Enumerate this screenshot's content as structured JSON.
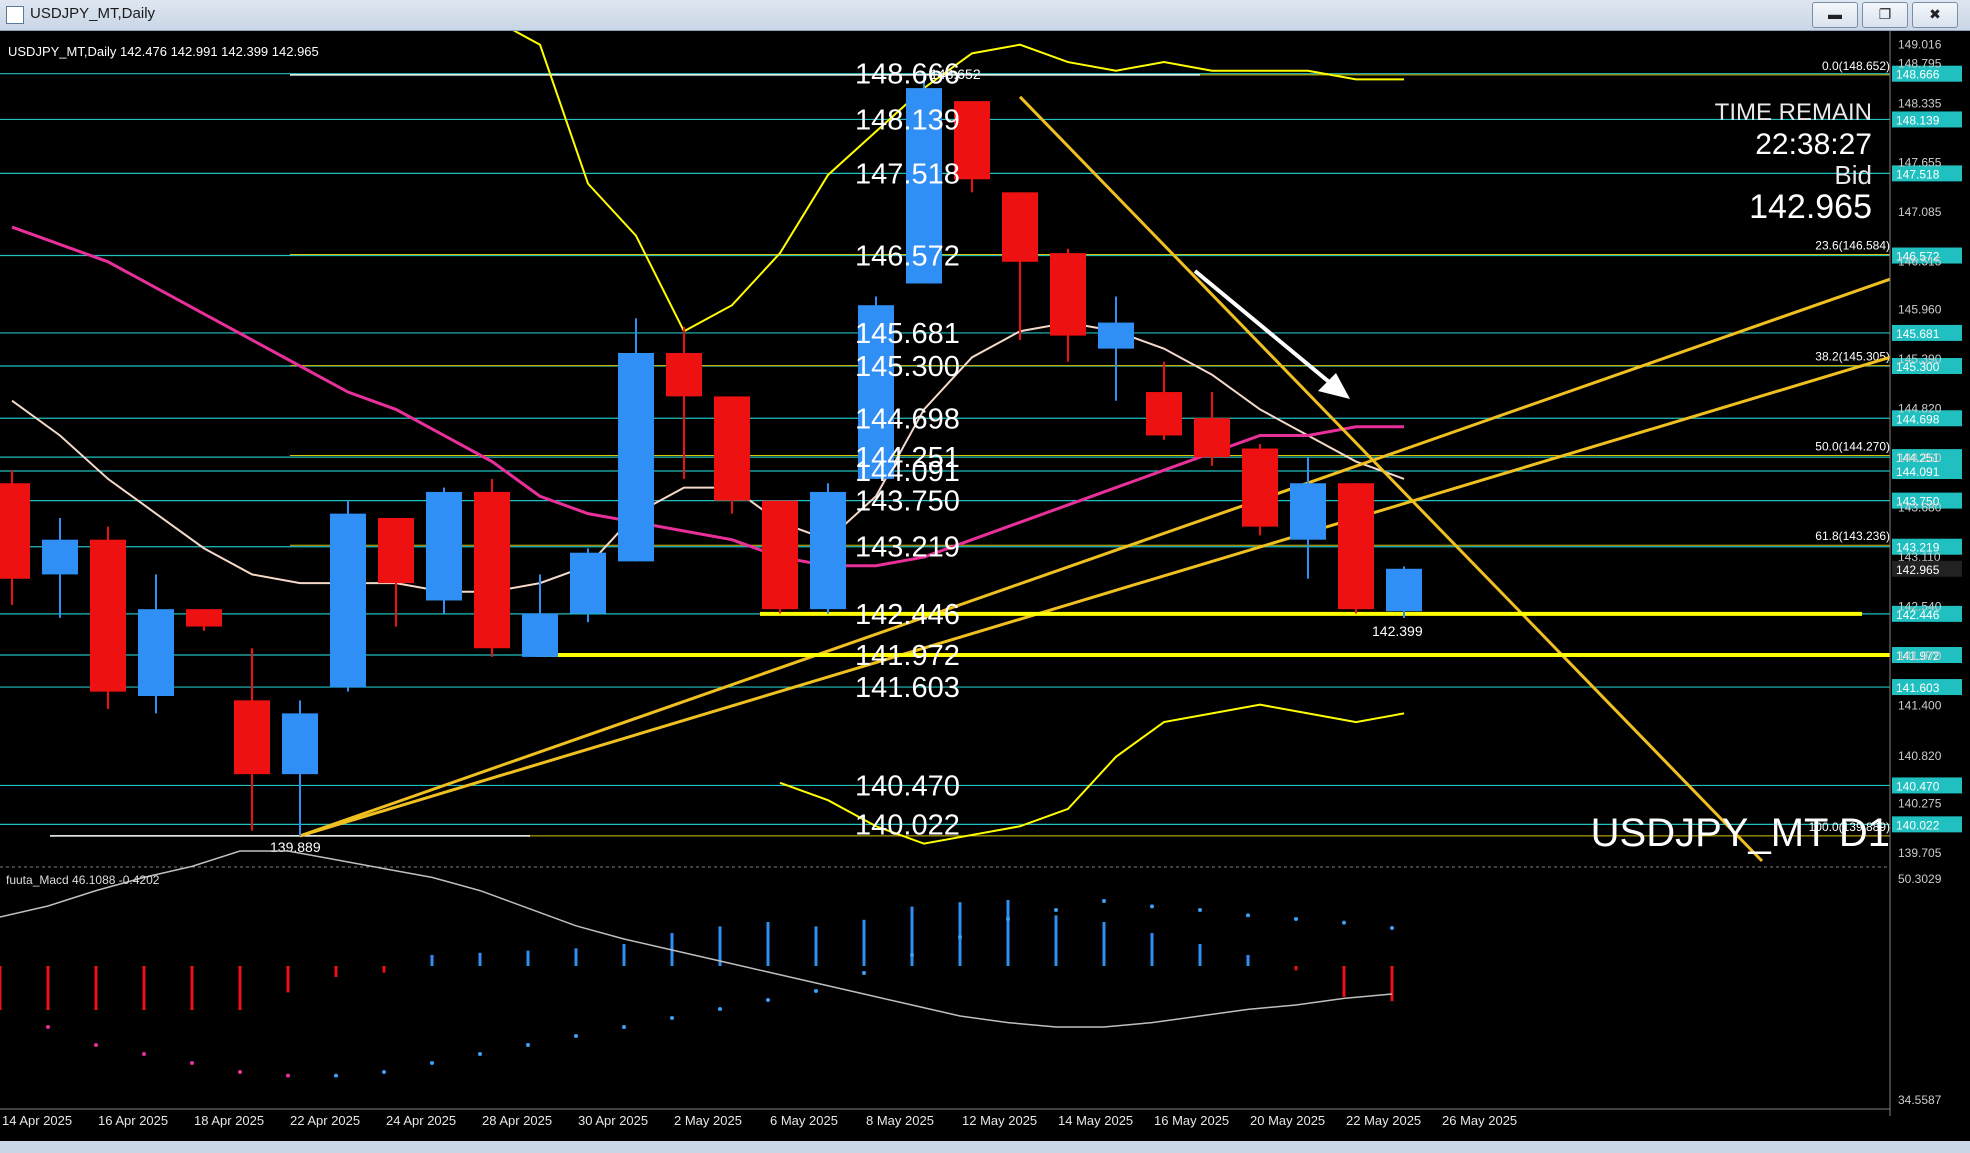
{
  "window": {
    "title": "USDJPY_MT,Daily",
    "buttons": [
      "minimize",
      "maximize",
      "close"
    ]
  },
  "header_info": "USDJPY_MT,Daily  142.476 142.991 142.399 142.965",
  "watermark": "USDJPY_MT D1",
  "time_remain": {
    "label": "TIME REMAIN",
    "value": "22:38:27",
    "bid_label": "Bid",
    "bid_value": "142.965"
  },
  "indicator_label": "fuuta_Macd 46.1088  -0.4202",
  "colors": {
    "bull": "#2f8ff5",
    "bear": "#ee1111",
    "background": "#000000",
    "hline": "#20c0c0",
    "fib": "#d8c000",
    "trend": "#f0c020",
    "bollinger": "#ffff00",
    "support": "#ffff00",
    "ma_pink": "#e8309a",
    "ma_white": "#f4d8c8"
  },
  "chart_data": {
    "type": "candlestick",
    "symbol": "USDJPY_MT",
    "timeframe": "Daily",
    "ohlc_current": {
      "open": 142.476,
      "high": 142.991,
      "low": 142.399,
      "close": 142.965
    },
    "candles": [
      {
        "o": 143.95,
        "h": 144.1,
        "l": 142.55,
        "c": 142.85
      },
      {
        "o": 142.9,
        "h": 143.55,
        "l": 142.4,
        "c": 143.3
      },
      {
        "o": 143.3,
        "h": 143.45,
        "l": 141.35,
        "c": 141.55
      },
      {
        "o": 141.5,
        "h": 142.9,
        "l": 141.3,
        "c": 142.5
      },
      {
        "o": 142.5,
        "h": 142.5,
        "l": 142.25,
        "c": 142.3
      },
      {
        "o": 141.45,
        "h": 142.05,
        "l": 139.95,
        "c": 140.6
      },
      {
        "o": 140.6,
        "h": 141.45,
        "l": 139.889,
        "c": 141.3
      },
      {
        "o": 141.6,
        "h": 143.75,
        "l": 141.55,
        "c": 143.6
      },
      {
        "o": 143.55,
        "h": 143.55,
        "l": 142.3,
        "c": 142.8
      },
      {
        "o": 142.6,
        "h": 143.9,
        "l": 142.45,
        "c": 143.85
      },
      {
        "o": 143.85,
        "h": 144.0,
        "l": 141.95,
        "c": 142.05
      },
      {
        "o": 141.95,
        "h": 142.9,
        "l": 141.95,
        "c": 142.45
      },
      {
        "o": 142.45,
        "h": 143.2,
        "l": 142.35,
        "c": 143.15
      },
      {
        "o": 143.05,
        "h": 145.85,
        "l": 143.05,
        "c": 145.45
      },
      {
        "o": 145.45,
        "h": 145.75,
        "l": 144.0,
        "c": 144.95
      },
      {
        "o": 144.95,
        "h": 144.95,
        "l": 143.6,
        "c": 143.75
      },
      {
        "o": 143.75,
        "h": 143.75,
        "l": 142.45,
        "c": 142.5
      },
      {
        "o": 142.5,
        "h": 143.95,
        "l": 142.446,
        "c": 143.85
      },
      {
        "o": 144.0,
        "h": 146.1,
        "l": 144.0,
        "c": 146.0
      },
      {
        "o": 146.25,
        "h": 148.652,
        "l": 146.25,
        "c": 148.5
      },
      {
        "o": 148.35,
        "h": 148.35,
        "l": 147.3,
        "c": 147.45
      },
      {
        "o": 147.3,
        "h": 147.3,
        "l": 145.6,
        "c": 146.5
      },
      {
        "o": 146.6,
        "h": 146.65,
        "l": 145.35,
        "c": 145.65
      },
      {
        "o": 145.5,
        "h": 146.1,
        "l": 144.9,
        "c": 145.8
      },
      {
        "o": 145.0,
        "h": 145.35,
        "l": 144.45,
        "c": 144.5
      },
      {
        "o": 144.7,
        "h": 145.0,
        "l": 144.15,
        "c": 144.25
      },
      {
        "o": 144.35,
        "h": 144.4,
        "l": 143.35,
        "c": 143.45
      },
      {
        "o": 143.3,
        "h": 144.25,
        "l": 142.85,
        "c": 143.95
      },
      {
        "o": 143.95,
        "h": 143.95,
        "l": 142.45,
        "c": 142.5
      },
      {
        "o": 142.476,
        "h": 142.991,
        "l": 142.399,
        "c": 142.965
      }
    ],
    "x_labels": [
      "14 Apr 2025",
      "16 Apr 2025",
      "18 Apr 2025",
      "22 Apr 2025",
      "24 Apr 2025",
      "28 Apr 2025",
      "30 Apr 2025",
      "2 May 2025",
      "6 May 2025",
      "8 May 2025",
      "12 May 2025",
      "14 May 2025",
      "16 May 2025",
      "20 May 2025",
      "22 May 2025",
      "26 May 2025"
    ],
    "y_ticks": [
      "149.016",
      "148.795",
      "148.335",
      "147.655",
      "147.085",
      "146.515",
      "145.960",
      "145.390",
      "144.820",
      "144.250",
      "143.680",
      "143.110",
      "142.540",
      "141.970",
      "141.400",
      "140.820",
      "140.275",
      "139.705"
    ],
    "ylim": [
      139.6,
      149.1
    ],
    "price_levels": [
      148.666,
      148.139,
      147.518,
      146.572,
      145.681,
      145.3,
      144.698,
      144.251,
      144.091,
      143.75,
      143.219,
      142.446,
      141.972,
      141.603,
      140.47,
      140.022
    ],
    "fib_levels": [
      {
        "label": "0.0(148.652)",
        "value": 148.652
      },
      {
        "label": "23.6(146.584)",
        "value": 146.584
      },
      {
        "label": "38.2(145.305)",
        "value": 145.305
      },
      {
        "label": "50.0(144.270)",
        "value": 144.27
      },
      {
        "label": "61.8(143.236)",
        "value": 143.236
      },
      {
        "label": "100.0(139.889)",
        "value": 139.889
      }
    ],
    "extremes": {
      "high_label": "148.652",
      "low_label": "139.889",
      "last_low_label": "142.399"
    },
    "macd_scale": {
      "top": "50.3029",
      "bottom": "34.5587"
    }
  }
}
